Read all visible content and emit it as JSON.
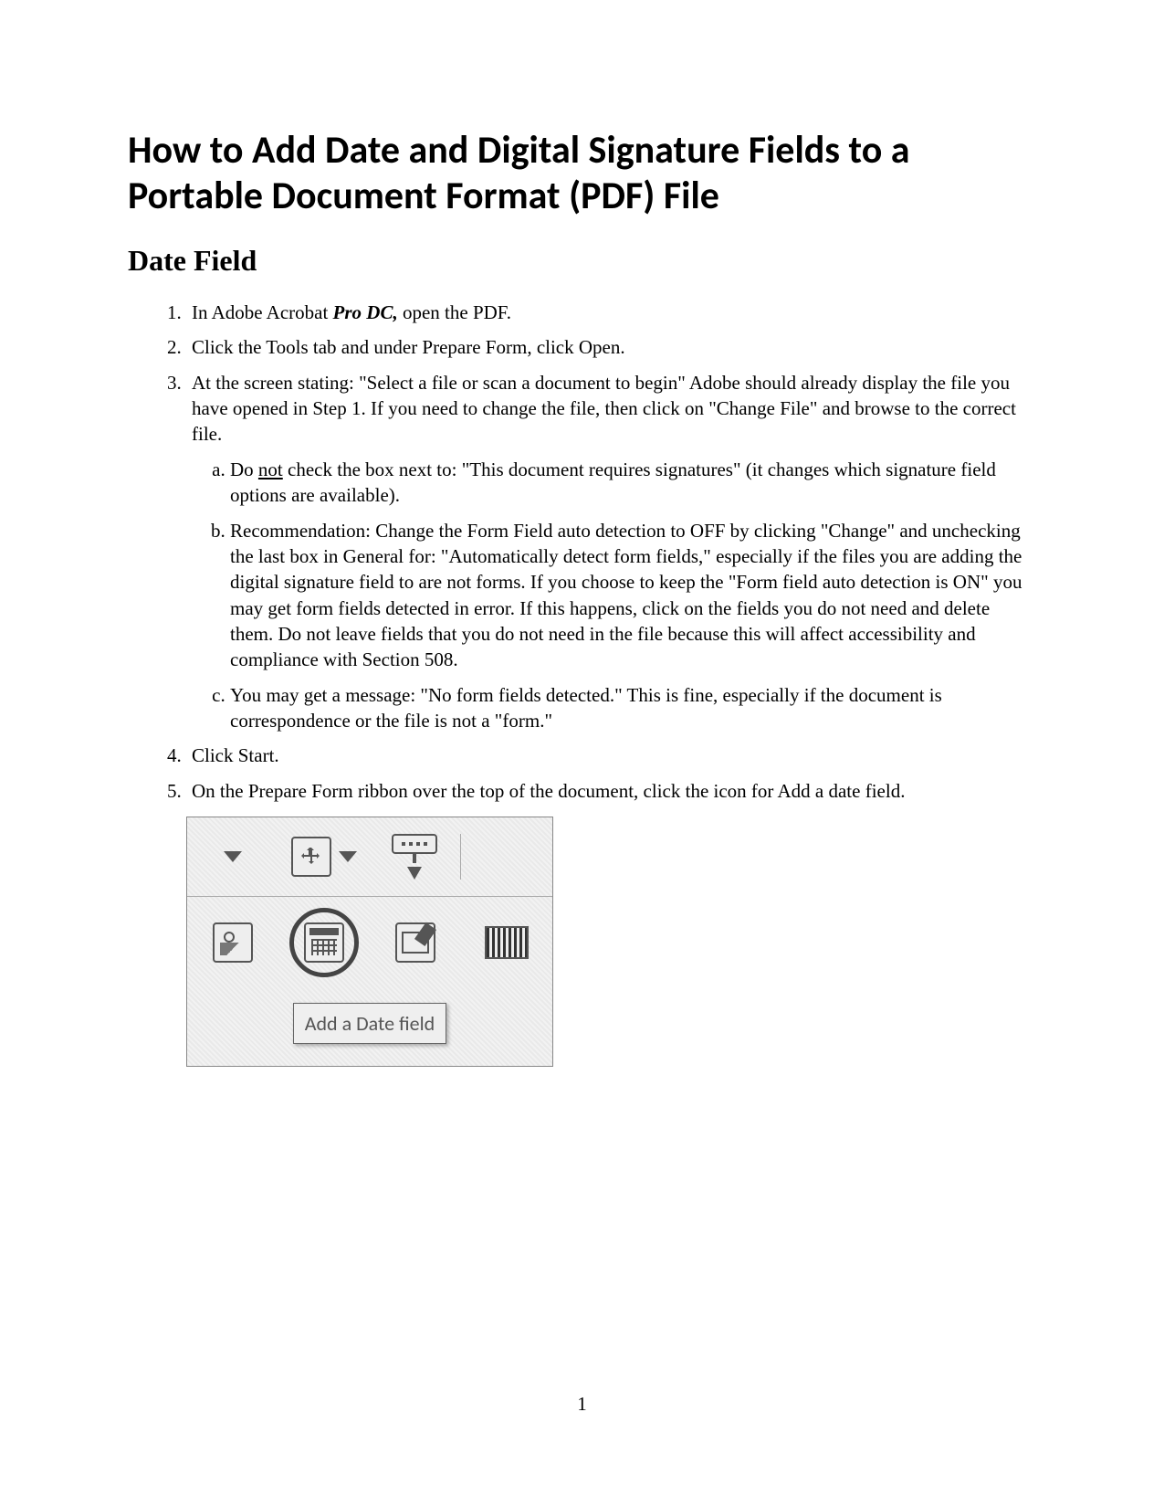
{
  "title": "How to Add Date and Digital Signature Fields to a Portable Document Format (PDF) File",
  "section_heading": "Date Field",
  "steps": {
    "s1_pre": "In Adobe Acrobat ",
    "s1_em": "Pro DC,",
    "s1_post": " open the PDF.",
    "s2": "Click the Tools tab and under Prepare Form, click Open.",
    "s3": "At the screen stating: \"Select a file or scan a document to begin\" Adobe should already display the file you have opened in Step 1.  If you need to change the file, then click on \"Change File\" and browse to the correct file.",
    "s3a_pre": "Do ",
    "s3a_u": "not",
    "s3a_post": " check the box next to: \"This document requires signatures\" (it changes which signature field options are available).",
    "s3b": "Recommendation:  Change the Form Field auto detection to OFF by clicking \"Change\" and unchecking the last box in General for: \"Automatically detect form fields,\" especially if the files you are adding the digital signature field to are not forms.  If you choose to keep the \"Form field auto detection is ON\" you may get form fields detected in error.  If this happens, click on the fields you do not need and delete them.  Do not leave fields that you do not need in the file because this will affect accessibility and compliance with Section 508.",
    "s3c": "You may get a message: \"No form fields detected.\"  This is fine, especially if the document is correspondence or the file is not a \"form.\"",
    "s4": "Click Start.",
    "s5": "On the Prepare Form ribbon over the top of the document, click the icon for Add a date field."
  },
  "figure": {
    "tooltip": "Add a Date field"
  },
  "page_number": "1"
}
